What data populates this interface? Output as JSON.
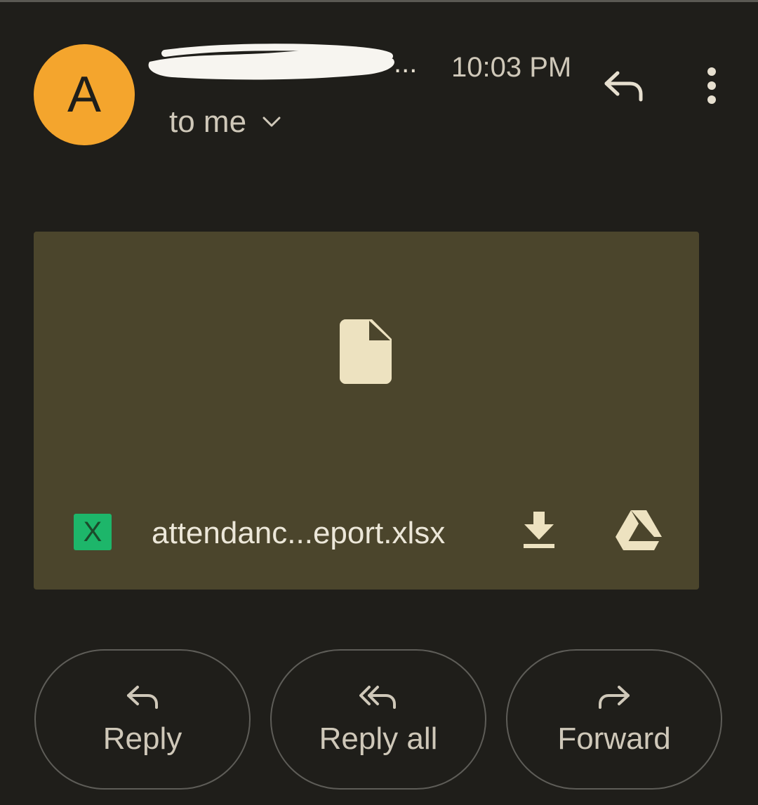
{
  "header": {
    "avatar_letter": "A",
    "sender_suffix": "...",
    "timestamp": "10:03 PM",
    "recipient": "to me",
    "icons": {
      "reply": "reply-arrow-icon",
      "more": "more-vert-icon",
      "recipient_toggle": "chevron-down-icon"
    }
  },
  "attachment": {
    "file_type_letter": "X",
    "file_name": "attendanc...eport.xlsx",
    "icons": {
      "preview": "file-icon",
      "download": "download-icon",
      "save_to_drive": "google-drive-icon"
    }
  },
  "actions": {
    "reply_label": "Reply",
    "reply_all_label": "Reply all",
    "forward_label": "Forward"
  },
  "colors": {
    "background": "#1f1e1a",
    "avatar": "#f4a52d",
    "attachment_card": "#4b452c",
    "spreadsheet_badge": "#1db66a",
    "text": "#e6dfcf"
  }
}
